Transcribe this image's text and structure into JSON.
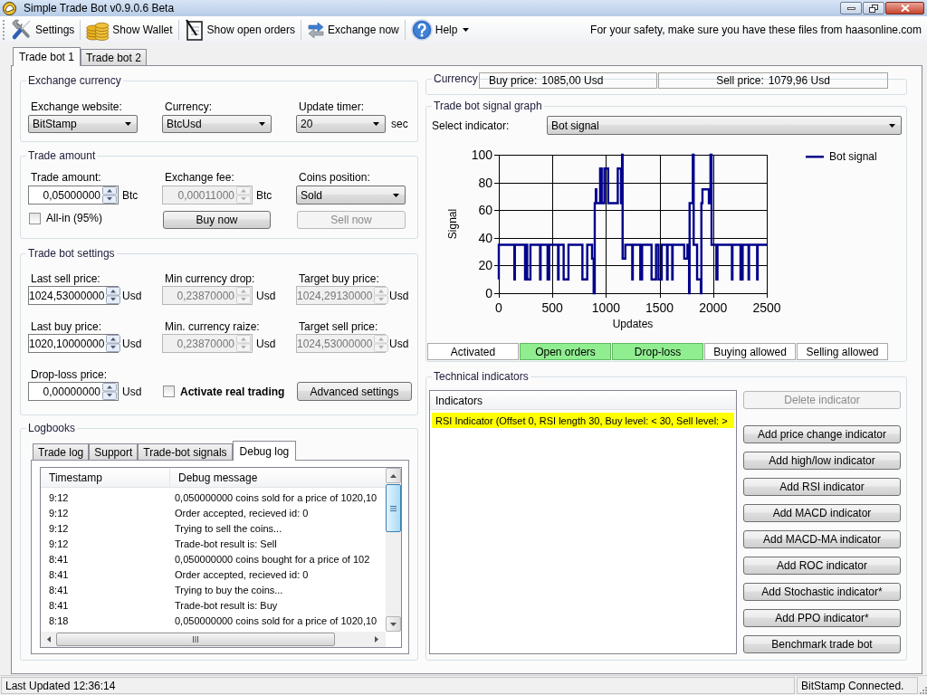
{
  "window": {
    "title": "Simple Trade Bot v0.9.0.6 Beta"
  },
  "toolbar": {
    "items": [
      {
        "label": "Settings",
        "dropdown": false
      },
      {
        "label": "Show Wallet",
        "dropdown": false
      },
      {
        "label": "Show open orders",
        "dropdown": false
      },
      {
        "label": "Exchange now",
        "dropdown": false
      },
      {
        "label": "Help",
        "dropdown": true
      }
    ],
    "notice": "For your safety, make sure you have these files from haasonline.com"
  },
  "tabs": [
    {
      "label": "Trade bot 1",
      "selected": true
    },
    {
      "label": "Trade bot 2",
      "selected": false
    }
  ],
  "exchange_currency": {
    "title": "Exchange currency",
    "fields": [
      {
        "label": "Exchange website:",
        "value": "BitStamp"
      },
      {
        "label": "Currency:",
        "value": "BtcUsd"
      },
      {
        "label": "Update timer:",
        "value": "20",
        "unit": "sec"
      }
    ]
  },
  "trade_amount": {
    "title": "Trade amount",
    "fields": [
      {
        "kind": "spin",
        "label": "Trade amount:",
        "value": "0,05000000",
        "unit": "Btc",
        "disabled": false
      },
      {
        "kind": "spin",
        "label": "Exchange fee:",
        "value": "0,00011000",
        "unit": "Btc",
        "disabled": true
      },
      {
        "kind": "select",
        "label": "Coins position:",
        "value": "Sold",
        "disabled": false
      }
    ],
    "all_in": {
      "label": "All-in (95%)",
      "checked": false
    },
    "buttons": [
      {
        "label": "Buy now",
        "disabled": false
      },
      {
        "label": "Sell now",
        "disabled": true
      }
    ]
  },
  "trade_bot_settings": {
    "title": "Trade bot settings",
    "fields": [
      {
        "label": "Last sell price:",
        "value": "1024,53000000",
        "unit": "Usd",
        "disabled": false
      },
      {
        "label": "Min currency drop:",
        "value": "0,23870000",
        "unit": "Usd",
        "disabled": true
      },
      {
        "label": "Target buy price:",
        "value": "1024,29130000",
        "unit": "Usd",
        "disabled": true
      },
      {
        "label": "Last buy price:",
        "value": "1020,10000000",
        "unit": "Usd",
        "disabled": false
      },
      {
        "label": "Min. currency raize:",
        "value": "0,23870000",
        "unit": "Usd",
        "disabled": true
      },
      {
        "label": "Target sell price:",
        "value": "1024,53000000",
        "unit": "Usd",
        "disabled": true
      },
      {
        "label": "Drop-loss price:",
        "value": "0,00000000",
        "unit": "Usd",
        "disabled": false
      }
    ],
    "real_trading": {
      "label": "Activate real trading",
      "checked": false
    },
    "advanced_button": "Advanced settings"
  },
  "logbooks": {
    "title": "Logbooks",
    "tabs": [
      {
        "label": "Trade log",
        "selected": false
      },
      {
        "label": "Support",
        "selected": false
      },
      {
        "label": "Trade-bot signals",
        "selected": false
      },
      {
        "label": "Debug log",
        "selected": true
      }
    ],
    "columns": [
      "Timestamp",
      "Debug message"
    ],
    "rows": [
      [
        "9:12",
        "0,050000000 coins sold for a price of 1020,10"
      ],
      [
        "9:12",
        "Order accepted, recieved id: 0"
      ],
      [
        "9:12",
        "Trying to sell the coins..."
      ],
      [
        "9:12",
        "Trade-bot result is: Sell"
      ],
      [
        "8:41",
        "0,050000000 coins bought for a price of 102"
      ],
      [
        "8:41",
        "Order accepted, recieved id: 0"
      ],
      [
        "8:41",
        "Trying to buy the coins..."
      ],
      [
        "8:41",
        "Trade-bot result is: Buy"
      ],
      [
        "8:18",
        "0,050000000 coins sold for a price of 1020,10"
      ]
    ]
  },
  "currency": {
    "title": "Currency",
    "prices": [
      {
        "label": "Buy price:",
        "value": "1085,00 Usd"
      },
      {
        "label": "Sell price:",
        "value": "1079,96 Usd"
      }
    ]
  },
  "signal_graph": {
    "title": "Trade bot signal graph",
    "select_label": "Select indicator:",
    "select_value": "Bot signal",
    "chart_data": {
      "type": "line",
      "grid": true,
      "xlabel": "Updates",
      "ylabel": "Signal",
      "x": [
        0,
        0,
        145,
        145,
        150,
        150,
        245,
        245,
        255,
        255,
        265,
        265,
        295,
        295,
        385,
        385,
        390,
        390,
        455,
        455,
        470,
        470,
        553,
        553,
        558,
        558,
        605,
        605,
        650,
        650,
        780,
        780,
        825,
        825,
        870,
        870,
        885,
        885,
        895,
        895,
        905,
        905,
        910,
        910,
        945,
        945,
        960,
        960,
        985,
        985,
        1020,
        1020,
        1110,
        1110,
        1140,
        1140,
        1150,
        1150,
        1155,
        1155,
        1180,
        1180,
        1245,
        1245,
        1250,
        1250,
        1320,
        1320,
        1337,
        1337,
        1425,
        1425,
        1467,
        1467,
        1490,
        1490,
        1520,
        1520,
        1570,
        1570,
        1575,
        1575,
        1618,
        1618,
        1622,
        1622,
        1730,
        1730,
        1760,
        1760,
        1775,
        1775,
        1780,
        1780,
        1810,
        1810,
        1818,
        1818,
        1850,
        1850,
        1885,
        1885,
        1890,
        1890,
        1900,
        1900,
        1960,
        1960,
        1975,
        1975,
        1985,
        1985,
        2030,
        2030,
        2040,
        2040,
        2175,
        2175,
        2180,
        2180,
        2255,
        2255,
        2275,
        2275,
        2330,
        2330,
        2335,
        2335,
        2410,
        2410,
        2415,
        2415,
        2500
      ],
      "series": [
        {
          "name": "Bot signal",
          "color": "#00008b",
          "values": [
            10,
            35,
            35,
            10,
            10,
            35,
            35,
            10,
            10,
            35,
            35,
            10,
            10,
            35,
            35,
            10,
            10,
            35,
            35,
            10,
            10,
            35,
            35,
            10,
            10,
            35,
            35,
            10,
            10,
            35,
            35,
            10,
            10,
            35,
            35,
            25,
            25,
            0,
            0,
            65,
            65,
            75,
            75,
            65,
            65,
            90,
            90,
            65,
            65,
            90,
            90,
            65,
            65,
            90,
            90,
            65,
            65,
            100,
            100,
            25,
            25,
            35,
            35,
            10,
            10,
            35,
            35,
            10,
            10,
            35,
            35,
            10,
            10,
            35,
            35,
            10,
            10,
            35,
            35,
            10,
            10,
            35,
            35,
            10,
            10,
            35,
            35,
            25,
            25,
            35,
            35,
            0,
            0,
            65,
            65,
            100,
            100,
            35,
            35,
            10,
            10,
            0,
            0,
            65,
            65,
            75,
            75,
            65,
            65,
            100,
            100,
            35,
            35,
            10,
            10,
            35,
            35,
            10,
            10,
            35,
            35,
            10,
            10,
            35,
            35,
            10,
            10,
            35,
            35,
            10,
            10,
            35,
            35
          ]
        }
      ],
      "xlim": [
        0,
        2500
      ],
      "ylim": [
        0,
        100
      ],
      "xticks": [
        0,
        500,
        1000,
        1500,
        2000,
        2500
      ],
      "yticks": [
        0,
        20,
        40,
        60,
        80,
        100
      ]
    },
    "status": [
      {
        "label": "Activated",
        "on": false
      },
      {
        "label": "Open orders",
        "on": true
      },
      {
        "label": "Drop-loss",
        "on": true
      },
      {
        "label": "Buying allowed",
        "on": false
      },
      {
        "label": "Selling allowed",
        "on": false
      }
    ]
  },
  "technical_indicators": {
    "title": "Technical indicators",
    "list_header": "Indicators",
    "items": [
      {
        "label": "RSI Indicator (Offset 0, RSI length 30, Buy level: < 30, Sell level: >",
        "color": "#ffff00"
      }
    ],
    "buttons": [
      {
        "label": "Delete indicator",
        "disabled": true
      },
      {
        "label": "Add price change indicator",
        "disabled": false
      },
      {
        "label": "Add high/low indicator",
        "disabled": false
      },
      {
        "label": "Add RSI indicator",
        "disabled": false
      },
      {
        "label": "Add MACD indicator",
        "disabled": false
      },
      {
        "label": "Add MACD-MA indicator",
        "disabled": false
      },
      {
        "label": "Add ROC indicator",
        "disabled": false
      },
      {
        "label": "Add Stochastic indicator*",
        "disabled": false
      },
      {
        "label": "Add PPO indicator*",
        "disabled": false
      },
      {
        "label": "Benchmark trade bot",
        "disabled": false
      }
    ]
  },
  "status_bar": {
    "left": "Last Updated 12:36:14",
    "right": "BitStamp Connected."
  }
}
